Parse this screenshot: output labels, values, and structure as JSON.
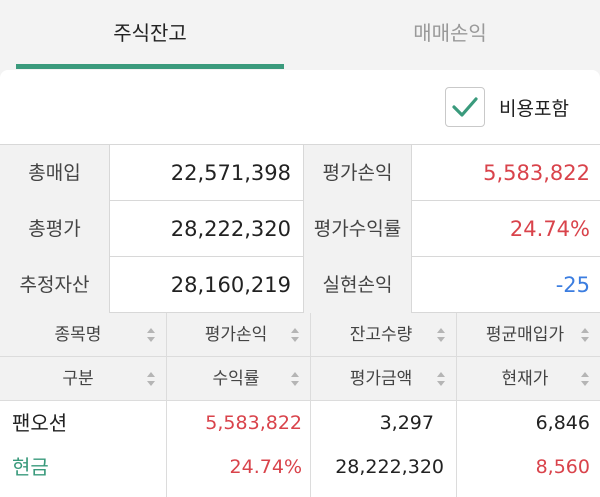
{
  "tabs": [
    {
      "label": "주식잔고",
      "active": true
    },
    {
      "label": "매매손익",
      "active": false
    }
  ],
  "fee_toggle": {
    "label": "비용포함",
    "checked": true
  },
  "summary": {
    "total_buy_label": "총매입",
    "total_buy_value": "22,571,398",
    "eval_pl_label": "평가손익",
    "eval_pl_value": "5,583,822",
    "total_eval_label": "총평가",
    "total_eval_value": "28,222,320",
    "eval_rate_label": "평가수익률",
    "eval_rate_value": "24.74%",
    "est_asset_label": "추정자산",
    "est_asset_value": "28,160,219",
    "realized_label": "실현손익",
    "realized_value": "-25"
  },
  "table": {
    "header1": [
      "종목명",
      "평가손익",
      "잔고수량",
      "평균매입가"
    ],
    "header2": [
      "구분",
      "수익률",
      "평가금액",
      "현재가"
    ],
    "stock": {
      "name": "팬오션",
      "type": "현금",
      "eval_pl": "5,583,822",
      "rate": "24.74%",
      "qty": "3,297",
      "eval_amount": "28,222,320",
      "avg_price": "6,846",
      "current_price": "8,560"
    }
  },
  "colors": {
    "accent": "#3a9a7c",
    "profit": "#d9434b",
    "loss": "#3b7de0"
  }
}
